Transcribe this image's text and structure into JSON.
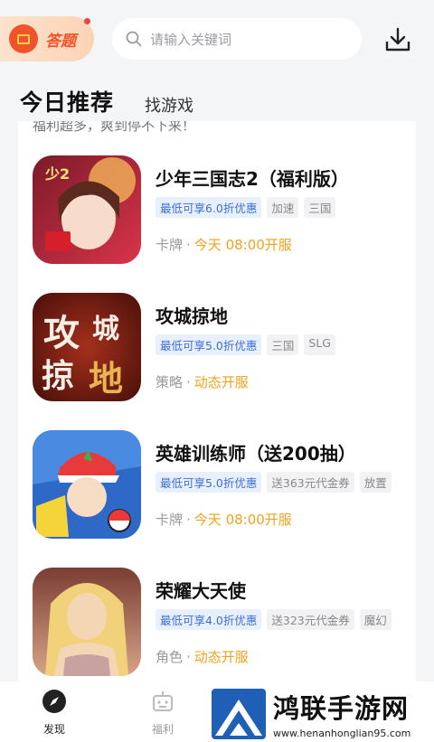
{
  "header": {
    "answer_label": "答题",
    "search_placeholder": "请输入关键词",
    "download_icon": "download-icon"
  },
  "tabs": {
    "main": "今日推荐",
    "secondary": "找游戏"
  },
  "banner_text": "福利超多，爽到停不下来！",
  "games": [
    {
      "title": "少年三国志2（福利版）",
      "tags": [
        "最低可享6.0折优惠",
        "加速",
        "三国"
      ],
      "category": "卡牌",
      "status": "今天 08:00开服",
      "icon_colors": [
        "#c2283a",
        "#f3b35a"
      ]
    },
    {
      "title": "攻城掠地",
      "tags": [
        "最低可享5.0折优惠",
        "三国",
        "SLG"
      ],
      "category": "策略",
      "status": "动态开服",
      "icon_colors": [
        "#7a1c14",
        "#e8b552"
      ]
    },
    {
      "title": "英雄训练师（送200抽）",
      "tags": [
        "最低可享5.0折优惠",
        "送363元代金券",
        "放置"
      ],
      "category": "卡牌",
      "status": "今天 08:00开服",
      "icon_colors": [
        "#2e69c7",
        "#f5d43a"
      ]
    },
    {
      "title": "荣耀大天使",
      "tags": [
        "最低可享4.0折优惠",
        "送323元代金券",
        "魔幻"
      ],
      "category": "角色",
      "status": "动态开服",
      "icon_colors": [
        "#b8755a",
        "#f5d6b4"
      ]
    }
  ],
  "meta_separator": "·",
  "bottom_nav": [
    {
      "label": "发现",
      "active": true
    },
    {
      "label": "福利",
      "active": false
    }
  ],
  "watermark": {
    "title": "鸿联手游网",
    "url": "www.henanhonglian95.com"
  },
  "colors": {
    "accent_orange": "#f2a21c",
    "discount_blue": "#3b6fd3",
    "brand_red": "#f0532a"
  }
}
